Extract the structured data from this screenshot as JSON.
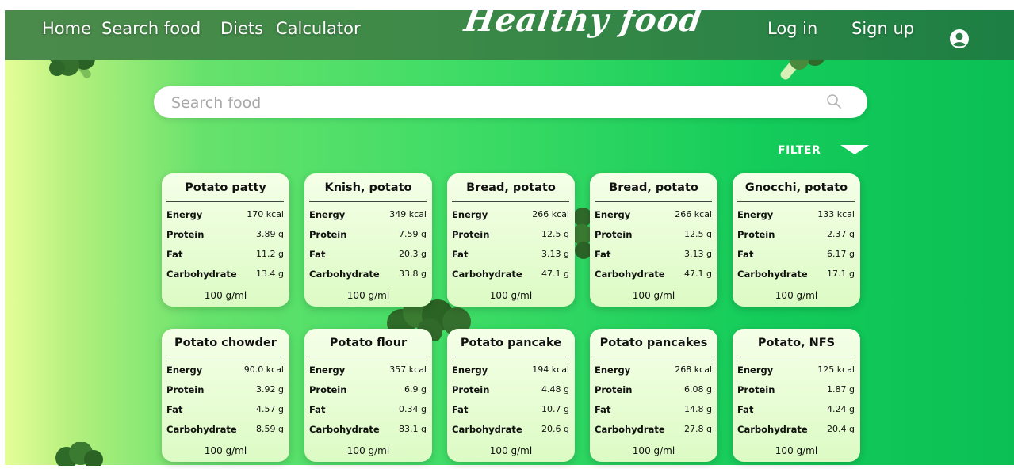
{
  "nav": {
    "links": [
      "Home",
      "Search food",
      "Diets",
      "Calculator"
    ],
    "logo": "Healthy food",
    "login": "Log in",
    "signup": "Sign up",
    "user_icon": "user-circle-icon"
  },
  "search": {
    "placeholder": "Search food",
    "icon": "search-icon"
  },
  "filter": {
    "label": "FILTER",
    "icon": "caret-down-icon"
  },
  "labels": {
    "energy": "Energy",
    "protein": "Protein",
    "fat": "Fat",
    "carbohydrate": "Carbohydrate"
  },
  "foods": [
    {
      "name": "Potato patty",
      "energy": "170 kcal",
      "protein": "3.89 g",
      "fat": "11.2 g",
      "carbohydrate": "13.4 g",
      "unit": "100 g/ml"
    },
    {
      "name": "Knish, potato",
      "energy": "349 kcal",
      "protein": "7.59 g",
      "fat": "20.3 g",
      "carbohydrate": "33.8 g",
      "unit": "100 g/ml"
    },
    {
      "name": "Bread, potato",
      "energy": "266 kcal",
      "protein": "12.5 g",
      "fat": "3.13 g",
      "carbohydrate": "47.1 g",
      "unit": "100 g/ml"
    },
    {
      "name": "Bread, potato",
      "energy": "266 kcal",
      "protein": "12.5 g",
      "fat": "3.13 g",
      "carbohydrate": "47.1 g",
      "unit": "100 g/ml"
    },
    {
      "name": "Gnocchi, potato",
      "energy": "133 kcal",
      "protein": "2.37 g",
      "fat": "6.17 g",
      "carbohydrate": "17.1 g",
      "unit": "100 g/ml"
    },
    {
      "name": "Potato chowder",
      "energy": "90.0 kcal",
      "protein": "3.92 g",
      "fat": "4.57 g",
      "carbohydrate": "8.59 g",
      "unit": "100 g/ml"
    },
    {
      "name": "Potato flour",
      "energy": "357 kcal",
      "protein": "6.9 g",
      "fat": "0.34 g",
      "carbohydrate": "83.1 g",
      "unit": "100 g/ml"
    },
    {
      "name": "Potato pancake",
      "energy": "194 kcal",
      "protein": "4.48 g",
      "fat": "10.7 g",
      "carbohydrate": "20.6 g",
      "unit": "100 g/ml"
    },
    {
      "name": "Potato pancakes",
      "energy": "268 kcal",
      "protein": "6.08 g",
      "fat": "14.8 g",
      "carbohydrate": "27.8 g",
      "unit": "100 g/ml"
    },
    {
      "name": "Potato, NFS",
      "energy": "125 kcal",
      "protein": "1.87 g",
      "fat": "4.24 g",
      "carbohydrate": "20.4 g",
      "unit": "100 g/ml"
    }
  ],
  "decor": {
    "image": "broccoli-illustration"
  },
  "colors": {
    "nav_bg": "#3f8a48",
    "card_bg": "#e6fcd2",
    "accent": "#14cc5a",
    "text": "#ffffff"
  }
}
